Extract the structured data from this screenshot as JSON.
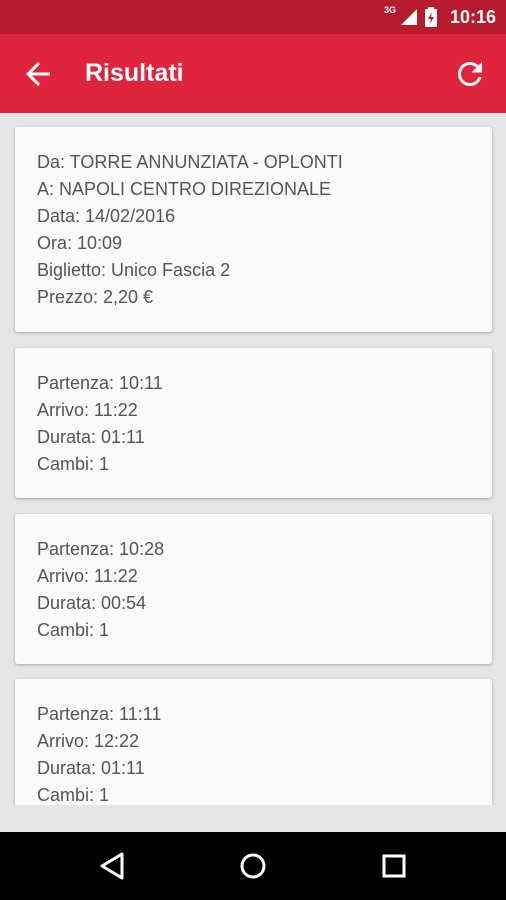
{
  "status": {
    "network": "3G",
    "time": "10:16"
  },
  "appbar": {
    "title": "Risultati"
  },
  "summary": {
    "from": "Da: TORRE ANNUNZIATA - OPLONTI",
    "to": "A: NAPOLI CENTRO DIREZIONALE",
    "date": "Data: 14/02/2016",
    "time": "Ora: 10:09",
    "ticket": "Biglietto: Unico Fascia 2",
    "price": "Prezzo: 2,20 €"
  },
  "results": [
    {
      "departure": "Partenza: 10:11",
      "arrival": "Arrivo: 11:22",
      "duration": "Durata: 01:11",
      "changes": "Cambi: 1"
    },
    {
      "departure": "Partenza: 10:28",
      "arrival": "Arrivo: 11:22",
      "duration": "Durata: 00:54",
      "changes": "Cambi: 1"
    },
    {
      "departure": "Partenza: 11:11",
      "arrival": "Arrivo: 12:22",
      "duration": "Durata: 01:11",
      "changes": "Cambi: 1"
    }
  ],
  "icons": {
    "back": "arrow-back-icon",
    "refresh": "refresh-icon",
    "nav_back": "triangle-back-icon",
    "nav_home": "circle-home-icon",
    "nav_recents": "square-recents-icon"
  },
  "colors": {
    "statusbar": "#b71c2c",
    "appbar": "#e0243b",
    "background": "#e6e6e6",
    "card": "#fafafa",
    "text": "#555555"
  }
}
